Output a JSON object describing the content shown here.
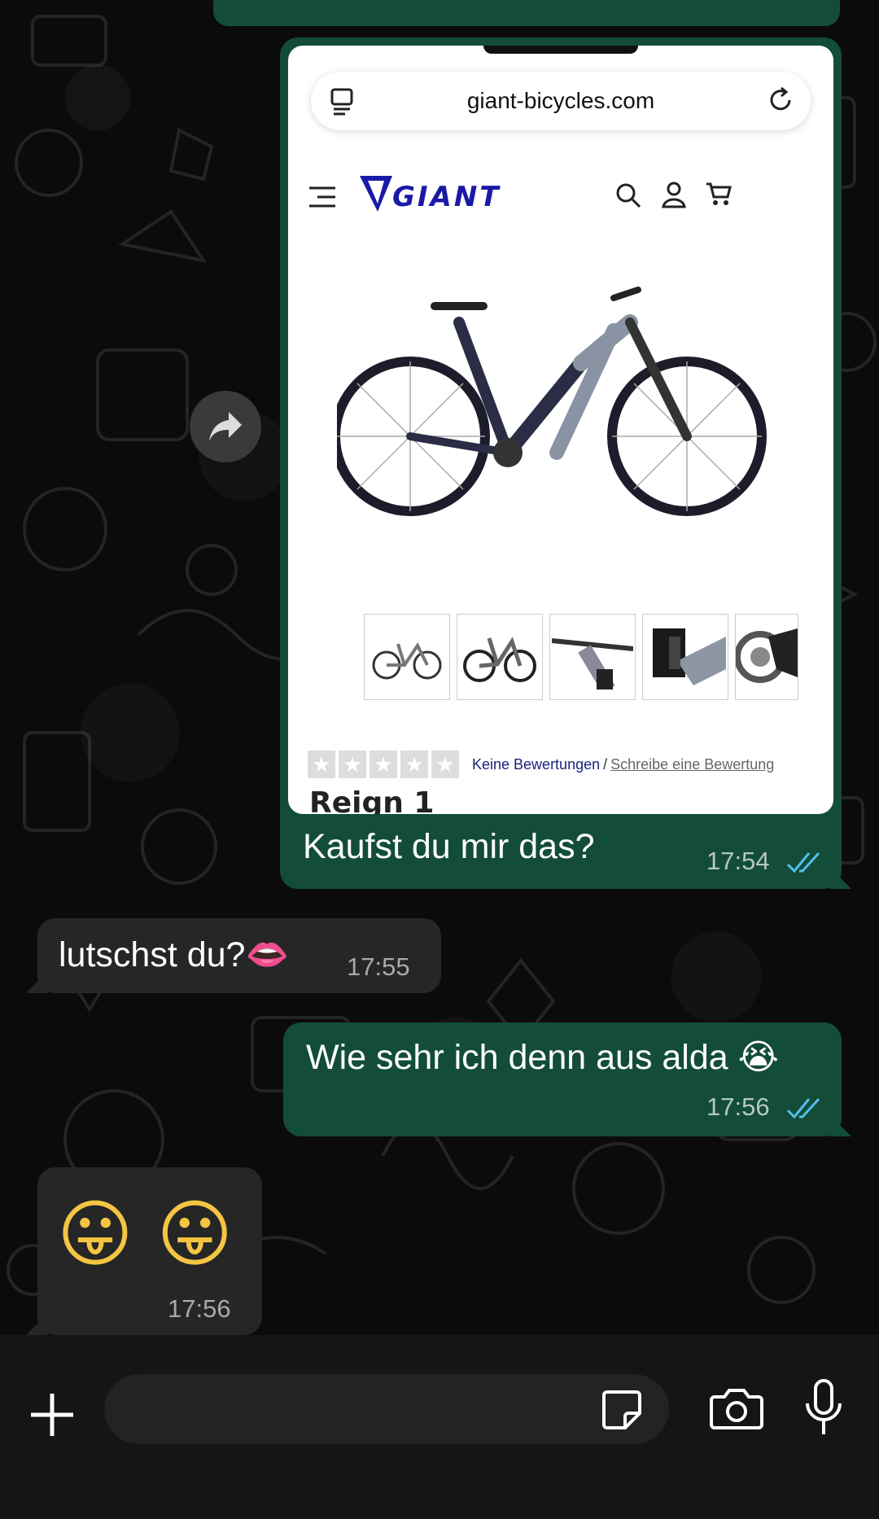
{
  "shared_screenshot": {
    "url": "giant-bicycles.com",
    "brand": "GIANT",
    "rating": {
      "no_reviews": "Keine Bewertungen",
      "separator": "/",
      "write_review": "Schreibe eine Bewertung",
      "stars": 0
    },
    "product_title": "Reign 1",
    "thumbnail_count": 5
  },
  "messages": [
    {
      "direction": "outgoing",
      "text": "Kaufst du mir das?",
      "time": "17:54",
      "status": "read"
    },
    {
      "direction": "incoming",
      "text": "lutschst du?",
      "emoji": "👄",
      "time": "17:55"
    },
    {
      "direction": "outgoing",
      "text": "Wie sehr ich denn aus alda",
      "emoji": "😭",
      "time": "17:56",
      "status": "read"
    },
    {
      "direction": "incoming",
      "emoji": "😛 😛",
      "time": "17:56"
    }
  ],
  "composer": {
    "value": "",
    "placeholder": ""
  },
  "icons": {
    "forward": "forward-arrow-icon",
    "attach": "plus-icon",
    "sticker": "sticker-icon",
    "camera": "camera-icon",
    "mic": "microphone-icon",
    "read_receipt": "double-check-icon"
  },
  "colors": {
    "outgoing_bubble": "#134d37",
    "incoming_bubble": "#262626",
    "read_tick": "#53bdeb",
    "background": "#0b0b0b",
    "brand_blue": "#1a1aa6"
  }
}
